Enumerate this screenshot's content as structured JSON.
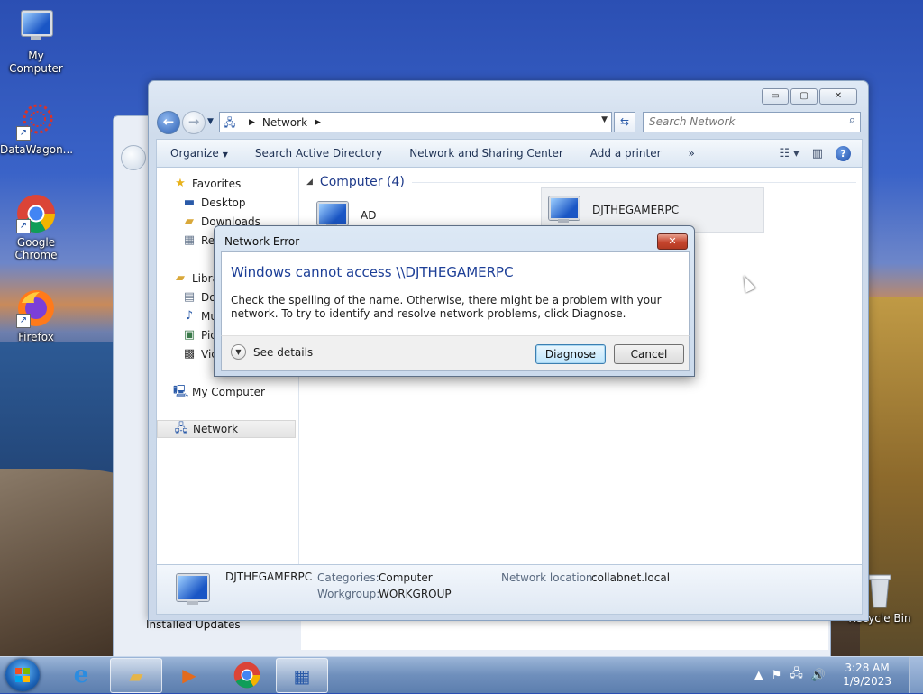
{
  "desktop": {
    "icons": [
      {
        "label": "My Computer"
      },
      {
        "label": "DataWagon..."
      },
      {
        "label": "Google Chrome"
      },
      {
        "label": "Firefox"
      },
      {
        "label": "Recycle Bin"
      }
    ],
    "background_window_text": "Installed Updates"
  },
  "explorer": {
    "caption_buttons": {
      "minimize": "▭",
      "maximize": "▢",
      "close": "✕"
    },
    "address": {
      "crumb": "Network"
    },
    "search": {
      "placeholder": "Search Network"
    },
    "toolbar": {
      "organize": "Organize",
      "items": [
        "Search Active Directory",
        "Network and Sharing Center",
        "Add a printer"
      ],
      "more": "»"
    },
    "nav": {
      "favorites": "Favorites",
      "desktop": "Desktop",
      "downloads": "Downloads",
      "recent": "Rec",
      "libraries": "Libra",
      "documents": "Do",
      "music": "Mu",
      "pictures": "Pic",
      "videos": "Vic",
      "my_computer": "My Computer",
      "network": "Network"
    },
    "group": {
      "header": "Computer (4)"
    },
    "computers": [
      {
        "name": "AD"
      },
      {
        "name": "DJTHEGAMERPC"
      }
    ],
    "details": {
      "name": "DJTHEGAMERPC",
      "categories_label": "Categories:",
      "categories_value": "Computer",
      "workgroup_label": "Workgroup:",
      "workgroup_value": "WORKGROUP",
      "network_location_label": "Network location:",
      "network_location_value": "collabnet.local"
    }
  },
  "dialog": {
    "title": "Network Error",
    "heading": "Windows cannot access \\\\DJTHEGAMERPC",
    "message": "Check the spelling of the name. Otherwise, there might be a problem with your network. To try to identify and resolve network problems, click Diagnose.",
    "see_details": "See details",
    "diagnose": "Diagnose",
    "cancel": "Cancel"
  },
  "taskbar": {
    "time": "3:28 AM",
    "date": "1/9/2023"
  },
  "colors": {
    "heading_blue": "#1d3f97",
    "taskbar": "#6f8fbc"
  }
}
